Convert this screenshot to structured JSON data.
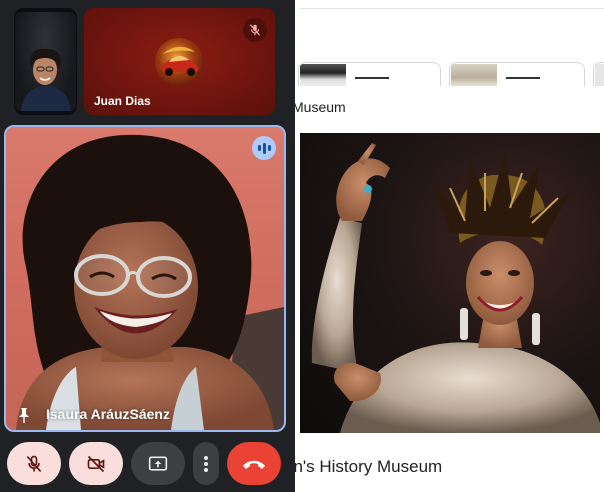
{
  "page": {
    "museum_label": "Museum",
    "caption": "en's History Museum"
  },
  "meeting": {
    "participants": [
      {
        "name": "Juan Dias",
        "muted": true
      },
      {
        "name": "Isaura AráuzSáenz",
        "speaking": true,
        "pinned": true
      }
    ],
    "controls": [
      {
        "name": "mic-off",
        "icon": "mic-off-icon",
        "state": "off"
      },
      {
        "name": "camera-off",
        "icon": "videocam-off-icon",
        "state": "off"
      },
      {
        "name": "present-screen",
        "icon": "present-to-all-icon"
      },
      {
        "name": "more-options",
        "icon": "more-vert-icon"
      },
      {
        "name": "leave-call",
        "icon": "call-end-icon"
      }
    ]
  },
  "colors": {
    "panel_bg": "#202124",
    "tile_red": "#6e150e",
    "control_dark": "#3c4043",
    "control_off": "#f9dedc",
    "leave_red": "#ea4335",
    "speaker_outline": "#9ab8f0"
  }
}
